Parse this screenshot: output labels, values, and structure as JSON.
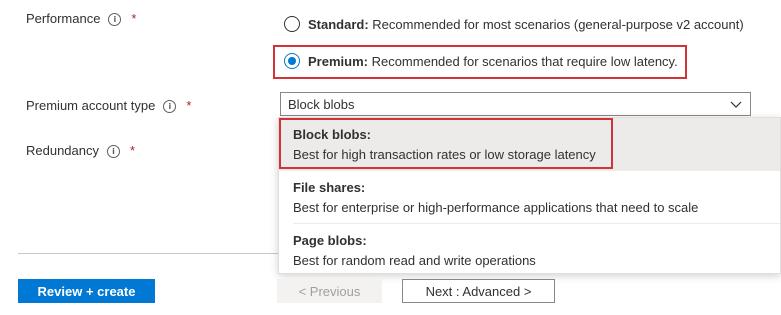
{
  "performance": {
    "label": "Performance",
    "required": "*",
    "options": [
      {
        "name": "Standard:",
        "desc": " Recommended for most scenarios (general-purpose v2 account)",
        "checked": false
      },
      {
        "name": "Premium:",
        "desc": " Recommended for scenarios that require low latency.",
        "checked": true
      }
    ]
  },
  "premium_type": {
    "label": "Premium account type",
    "required": "*",
    "selected": "Block blobs",
    "options": [
      {
        "title": "Block blobs:",
        "desc": "Best for high transaction rates or low storage latency"
      },
      {
        "title": "File shares:",
        "desc": "Best for enterprise or high-performance applications that need to scale"
      },
      {
        "title": "Page blobs:",
        "desc": "Best for random read and write operations"
      }
    ]
  },
  "redundancy": {
    "label": "Redundancy",
    "required": "*"
  },
  "info_glyph": "i",
  "footer": {
    "review": "Review + create",
    "previous": "< Previous",
    "next": "Next : Advanced >"
  },
  "colors": {
    "accent": "#0078d4",
    "highlight": "#d13438",
    "required": "#a4262c"
  }
}
